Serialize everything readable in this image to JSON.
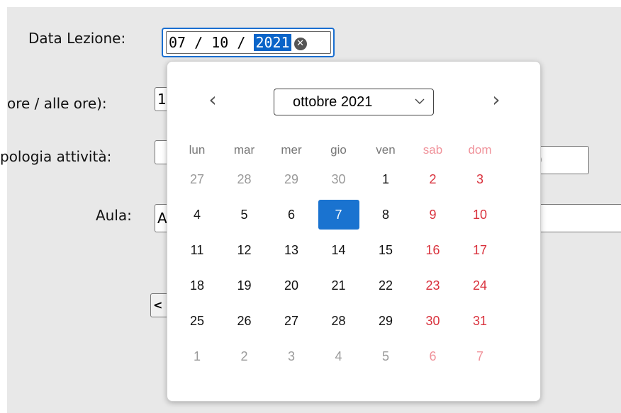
{
  "form": {
    "date_label": "Data Lezione:",
    "date_value": {
      "day": "07",
      "sep1": " / ",
      "month": "10",
      "sep2": " / ",
      "year": "2021"
    },
    "clear_icon": "clear-x-icon",
    "time_label": "ore / alle ore):",
    "time_value": "1",
    "activity_label": "pologia attività:",
    "activity_value": "",
    "activity_right_value": "0",
    "room_label": "Aula:",
    "room_value": "A",
    "button_partial": "<"
  },
  "calendar": {
    "prev_icon": "chevron-left-icon",
    "next_icon": "chevron-right-icon",
    "month_label": "ottobre 2021",
    "weekdays": [
      "lun",
      "mar",
      "mer",
      "gio",
      "ven",
      "sab",
      "dom"
    ],
    "weeks": [
      [
        "27",
        "28",
        "29",
        "30",
        "1",
        "2",
        "3"
      ],
      [
        "4",
        "5",
        "6",
        "7",
        "8",
        "9",
        "10"
      ],
      [
        "11",
        "12",
        "13",
        "14",
        "15",
        "16",
        "17"
      ],
      [
        "18",
        "19",
        "20",
        "21",
        "22",
        "23",
        "24"
      ],
      [
        "25",
        "26",
        "27",
        "28",
        "29",
        "30",
        "31"
      ],
      [
        "1",
        "2",
        "3",
        "4",
        "5",
        "6",
        "7"
      ]
    ],
    "out_of_month": [
      [
        true,
        true,
        true,
        true,
        false,
        false,
        false
      ],
      [
        false,
        false,
        false,
        false,
        false,
        false,
        false
      ],
      [
        false,
        false,
        false,
        false,
        false,
        false,
        false
      ],
      [
        false,
        false,
        false,
        false,
        false,
        false,
        false
      ],
      [
        false,
        false,
        false,
        false,
        false,
        false,
        false
      ],
      [
        true,
        true,
        true,
        true,
        true,
        true,
        true
      ]
    ],
    "selected": {
      "week": 1,
      "weekday": 3
    }
  },
  "colors": {
    "accent": "#0a64c8",
    "selected_day_bg": "#1a73d0",
    "weekend_text": "#d9323d",
    "weekend_faded": "#f0929a",
    "weekday_text": "#111111",
    "faded_text": "#9a9a9a",
    "weekday_header": "#777777",
    "weekend_header": "#f0929a"
  }
}
